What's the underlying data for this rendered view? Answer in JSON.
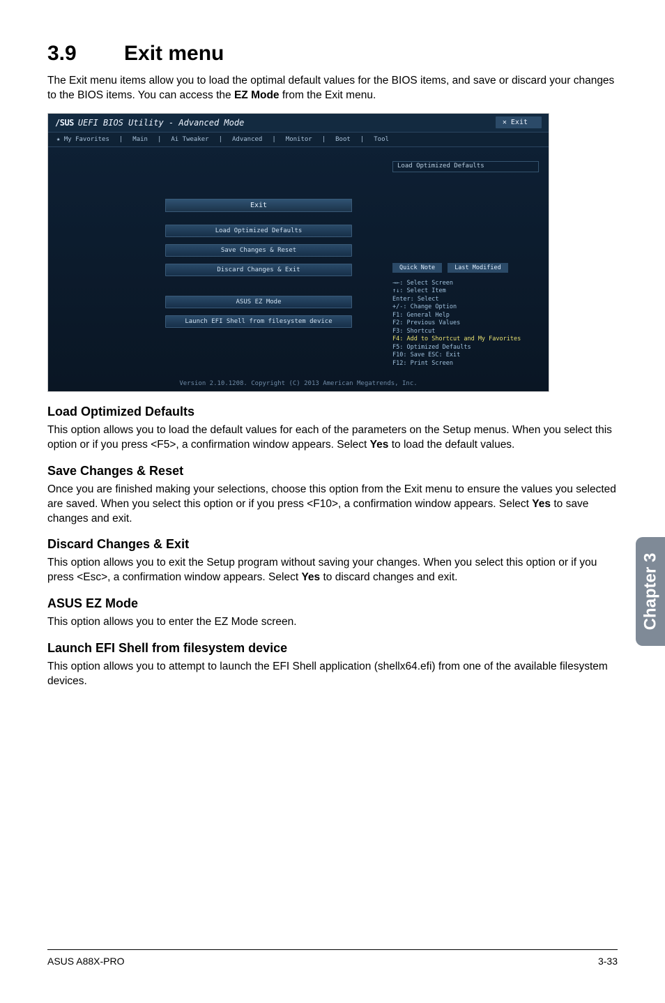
{
  "sideTab": "Chapter 3",
  "section": {
    "num": "3.9",
    "title": "Exit menu"
  },
  "intro": {
    "t1": "The Exit menu items allow you to load the optimal default values for the BIOS items, and save or discard your changes to the BIOS items. You can access the ",
    "bold1": "EZ Mode",
    "t2": " from the Exit menu."
  },
  "screenshot": {
    "brand": "/SUS",
    "topTitle": "UEFI BIOS Utility - Advanced Mode",
    "exitPill": "Exit",
    "tabs": [
      "★ My Favorites",
      "Main",
      "Ai Tweaker",
      "Advanced",
      "Monitor",
      "Boot",
      "Tool"
    ],
    "rightTop": "Load Optimized Defaults",
    "miniBtn1": "Quick Note",
    "miniBtn2": "Last Modified",
    "help": [
      "→←: Select Screen",
      "↑↓: Select Item",
      "Enter: Select",
      "+/-: Change Option",
      "F1: General Help",
      "F2: Previous Values",
      "F3: Shortcut",
      "F4: Add to Shortcut and My Favorites",
      "F5: Optimized Defaults",
      "F10: Save  ESC: Exit",
      "F12: Print Screen"
    ],
    "exitHeader": "Exit",
    "buttons": [
      "Load Optimized Defaults",
      "Save Changes & Reset",
      "Discard Changes & Exit",
      "ASUS EZ Mode",
      "Launch EFI Shell from filesystem device"
    ],
    "footer": "Version 2.10.1208. Copyright (C) 2013 American Megatrends, Inc."
  },
  "sections": [
    {
      "h": "Load Optimized Defaults",
      "p": {
        "t1": "This option allows you to load the default values for each of the parameters on the Setup menus. When you select this option or if you press <F5>, a confirmation window appears. Select ",
        "b": "Yes",
        "t2": " to load the default values."
      }
    },
    {
      "h": "Save Changes & Reset",
      "p": {
        "t1": "Once you are finished making your selections, choose this option from the Exit menu to ensure the values you selected are saved. When you select this option or if you press <F10>, a confirmation window appears. Select ",
        "b": "Yes",
        "t2": " to save changes and exit."
      }
    },
    {
      "h": "Discard Changes & Exit",
      "p": {
        "t1": "This option allows you to exit the Setup program without saving your changes. When you select this option or if you press <Esc>, a confirmation window appears. Select ",
        "b": "Yes",
        "t2": " to discard changes and exit."
      }
    },
    {
      "h": "ASUS EZ Mode",
      "p": {
        "t1": "This option allows you to enter the EZ Mode screen.",
        "b": "",
        "t2": ""
      }
    },
    {
      "h": "Launch EFI Shell from filesystem device",
      "p": {
        "t1": "This option allows you to attempt to launch the EFI Shell application (shellx64.efi) from one of the available filesystem devices.",
        "b": "",
        "t2": ""
      }
    }
  ],
  "footer": {
    "left": "ASUS A88X-PRO",
    "right": "3-33"
  }
}
